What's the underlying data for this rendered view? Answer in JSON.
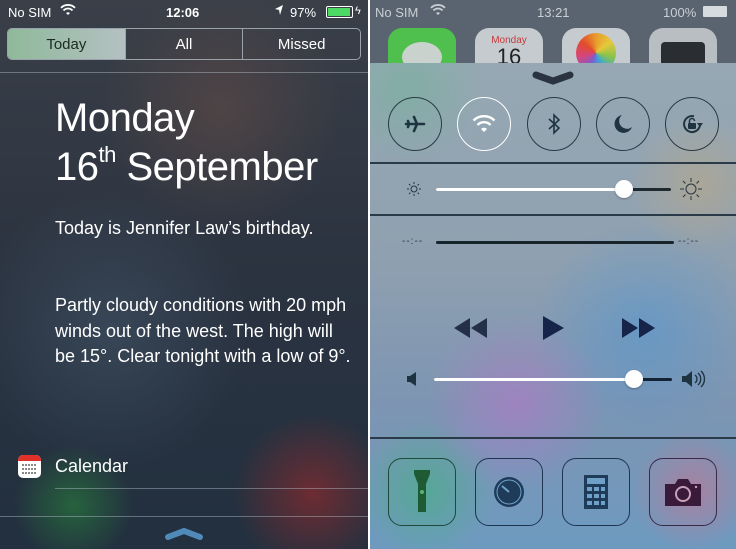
{
  "left": {
    "status_bar": {
      "carrier": "No SIM",
      "time": "12:06",
      "battery": "97%",
      "battery_level": 0.97,
      "battery_color": "#4cd964"
    },
    "tabs": [
      {
        "label": "Today",
        "selected": true
      },
      {
        "label": "All",
        "selected": false
      },
      {
        "label": "Missed",
        "selected": false
      }
    ],
    "date": {
      "weekday": "Monday",
      "day": "16",
      "suffix": "th",
      "month": "September"
    },
    "summary": {
      "birthday": "Today is Jennifer Law’s birthday.",
      "weather": "Partly cloudy conditions with 20 mph winds out of the west. The high will be 15°. Clear tonight with a low of 9°."
    },
    "widget": {
      "label": "Calendar",
      "icon": "calendar-icon"
    },
    "grabber": "chevron-up-icon"
  },
  "right": {
    "status_bar": {
      "carrier": "No SIM",
      "time": "13:21",
      "battery": "100%",
      "battery_level": 1.0
    },
    "background_apps": [
      {
        "name": "Messages",
        "color": "#5ed45b"
      },
      {
        "name": "Calendar",
        "label": "Monday",
        "number": "16"
      },
      {
        "name": "Photos"
      },
      {
        "name": "Camera"
      }
    ],
    "grabber": "chevron-down-icon",
    "toggles": [
      {
        "name": "airplane-mode",
        "icon": "airplane-icon",
        "on": false
      },
      {
        "name": "wifi",
        "icon": "wifi-icon",
        "on": true
      },
      {
        "name": "bluetooth",
        "icon": "bluetooth-icon",
        "on": false
      },
      {
        "name": "do-not-disturb",
        "icon": "moon-icon",
        "on": false
      },
      {
        "name": "rotation-lock",
        "icon": "rotation-lock-icon",
        "on": false
      }
    ],
    "brightness": {
      "value": 0.8
    },
    "media": {
      "elapsed": "--:--",
      "remaining": "--:--",
      "progress": 0.0
    },
    "volume": {
      "value": 0.84
    },
    "quick_launch": [
      {
        "name": "flashlight",
        "icon": "flashlight-icon"
      },
      {
        "name": "timer",
        "icon": "timer-icon"
      },
      {
        "name": "calculator",
        "icon": "calculator-icon"
      },
      {
        "name": "camera",
        "icon": "camera-icon"
      }
    ]
  }
}
